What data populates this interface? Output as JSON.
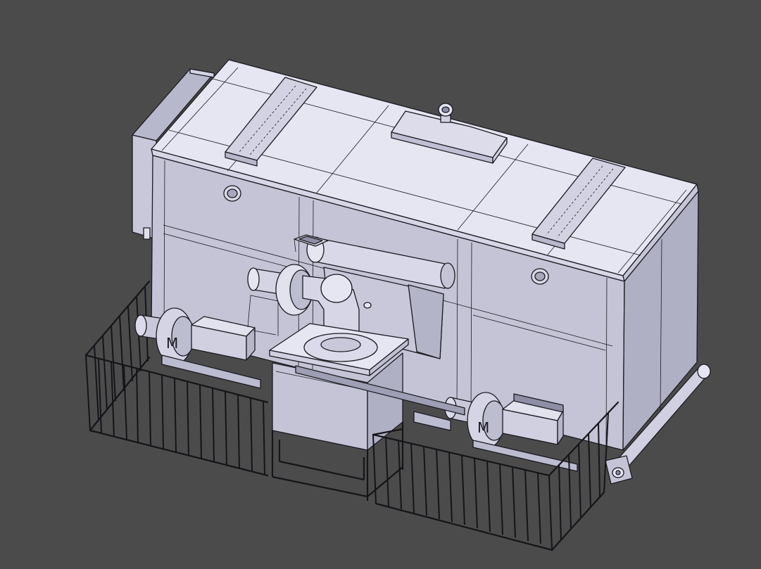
{
  "scene": {
    "background_color": "#4b4b4b",
    "body_colors": {
      "top": "#e6e6f2",
      "front": "#c4c4d6",
      "side": "#b0b0c4",
      "shadow": "#8e8ea4",
      "edge": "#1a1a22"
    },
    "icons": [
      "enclosure-body",
      "lifting-eye-icon",
      "exhaust-pipe",
      "centrifugal-blower-icon",
      "railing-fence",
      "support-frame"
    ]
  }
}
